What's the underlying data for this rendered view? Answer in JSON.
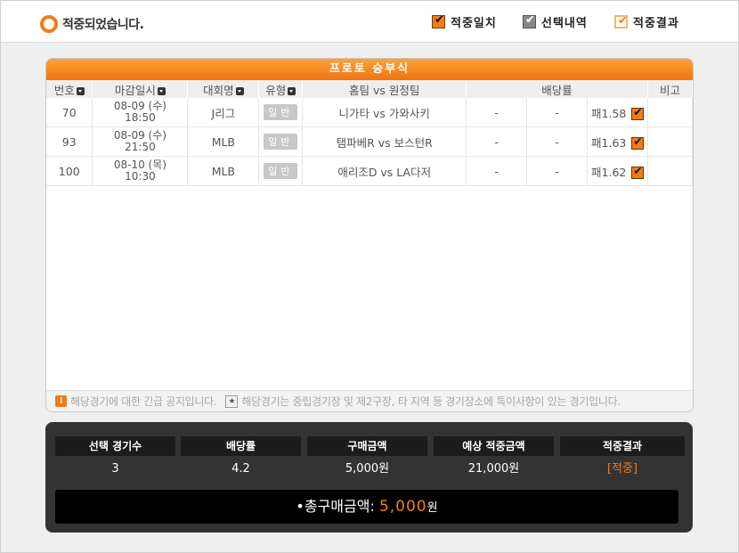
{
  "header": {
    "hit_message": "적중되었습니다.",
    "legend": [
      {
        "label": "적중일치",
        "style": "match"
      },
      {
        "label": "선택내역",
        "style": "select"
      },
      {
        "label": "적중결과",
        "style": "result"
      }
    ]
  },
  "game": {
    "title": "프로토 승부식",
    "columns": [
      "번호",
      "마감일시",
      "대회명",
      "유형",
      "홈팀 vs 원정팀",
      "배당률",
      "비고"
    ],
    "rows": [
      {
        "no": "70",
        "date": "08-09 (수)",
        "time": "18:50",
        "league": "J리그",
        "type": "일반",
        "match": "니가타 vs 가와사키",
        "odd1": "-",
        "odd2": "-",
        "odd3": "패1.58",
        "note": ""
      },
      {
        "no": "93",
        "date": "08-09 (수)",
        "time": "21:50",
        "league": "MLB",
        "type": "일반",
        "match": "탬파베R vs 보스턴R",
        "odd1": "-",
        "odd2": "-",
        "odd3": "패1.63",
        "note": ""
      },
      {
        "no": "100",
        "date": "08-10 (목)",
        "time": "10:30",
        "league": "MLB",
        "type": "일반",
        "match": "애리조D vs LA다저",
        "odd1": "-",
        "odd2": "-",
        "odd3": "패1.62",
        "note": ""
      }
    ],
    "notice_urgent": "해당경기에 대한 긴급 공지입니다.",
    "notice_neutral": "해당경기는 중립경기장 및 제2구장, 타 지역 등 경기장소에 특이사항이 있는 경기입니다."
  },
  "summary": {
    "headers": [
      "선택 경기수",
      "배당률",
      "구매금액",
      "예상 적중금액",
      "적중결과"
    ],
    "values": [
      "3",
      "4.2",
      "5,000원",
      "21,000원",
      "[적중]"
    ],
    "total_label": "•총구매금액:",
    "total_amount": "5,000",
    "total_unit": "원"
  },
  "colors": {
    "accent": "#f07c17",
    "dark_panel": "#333333"
  }
}
